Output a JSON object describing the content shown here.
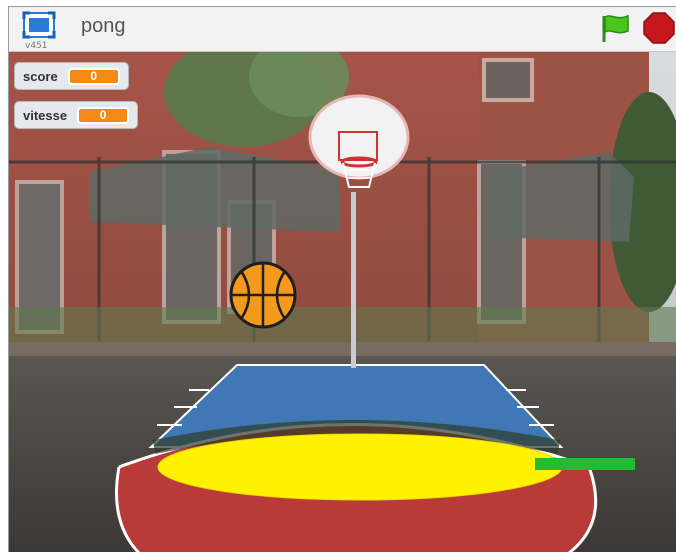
{
  "titlebar": {
    "project_title": "pong",
    "version": "v451"
  },
  "monitors": [
    {
      "label": "score",
      "value": "0"
    },
    {
      "label": "vitesse",
      "value": "0"
    }
  ],
  "colors": {
    "monitor_value": "#f28a13",
    "ball": "#f39a1c",
    "yellow_zone": "#fff200",
    "paddle": "#22bb33",
    "flag": "#33bb22",
    "stop": "#cc1111"
  },
  "icons": [
    "fullscreen-icon",
    "green-flag-icon",
    "stop-sign-icon"
  ]
}
